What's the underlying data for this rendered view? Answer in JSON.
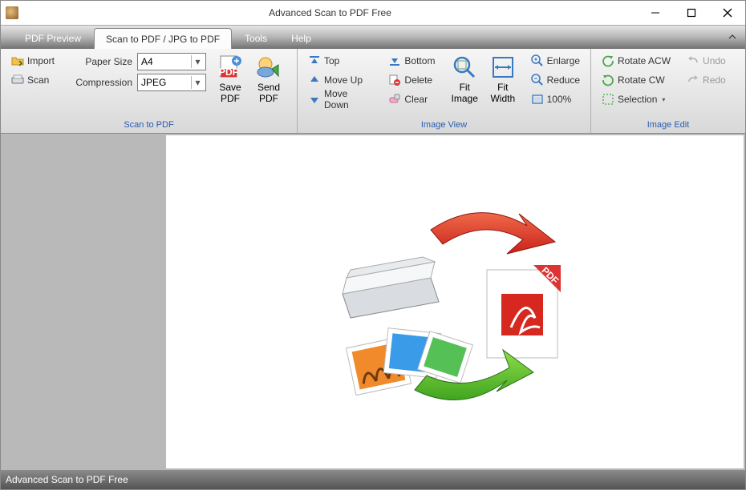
{
  "window": {
    "title": "Advanced Scan to PDF Free"
  },
  "tabs": {
    "pdf_preview": "PDF Preview",
    "scan_to_pdf": "Scan to PDF / JPG to PDF",
    "tools": "Tools",
    "help": "Help",
    "active": "scan_to_pdf"
  },
  "ribbon": {
    "group1": {
      "import": "Import",
      "scan": "Scan",
      "paper_size_label": "Paper Size",
      "paper_size_value": "A4",
      "compression_label": "Compression",
      "compression_value": "JPEG",
      "save_pdf_top": "Save",
      "save_pdf_bot": "PDF",
      "send_pdf_top": "Send",
      "send_pdf_bot": "PDF",
      "label": "Scan to PDF"
    },
    "group2": {
      "top": "Top",
      "move_up": "Move Up",
      "move_down": "Move Down",
      "bottom": "Bottom",
      "delete": "Delete",
      "clear": "Clear",
      "fit_image_top": "Fit",
      "fit_image_bot": "Image",
      "fit_width_top": "Fit",
      "fit_width_bot": "Width",
      "enlarge": "Enlarge",
      "reduce": "Reduce",
      "p100": "100%",
      "label": "Image View"
    },
    "group3": {
      "rotate_acw": "Rotate ACW",
      "rotate_cw": "Rotate CW",
      "selection": "Selection",
      "undo": "Undo",
      "redo": "Redo",
      "label": "Image Edit"
    }
  },
  "status": {
    "text": "Advanced Scan to PDF Free"
  }
}
